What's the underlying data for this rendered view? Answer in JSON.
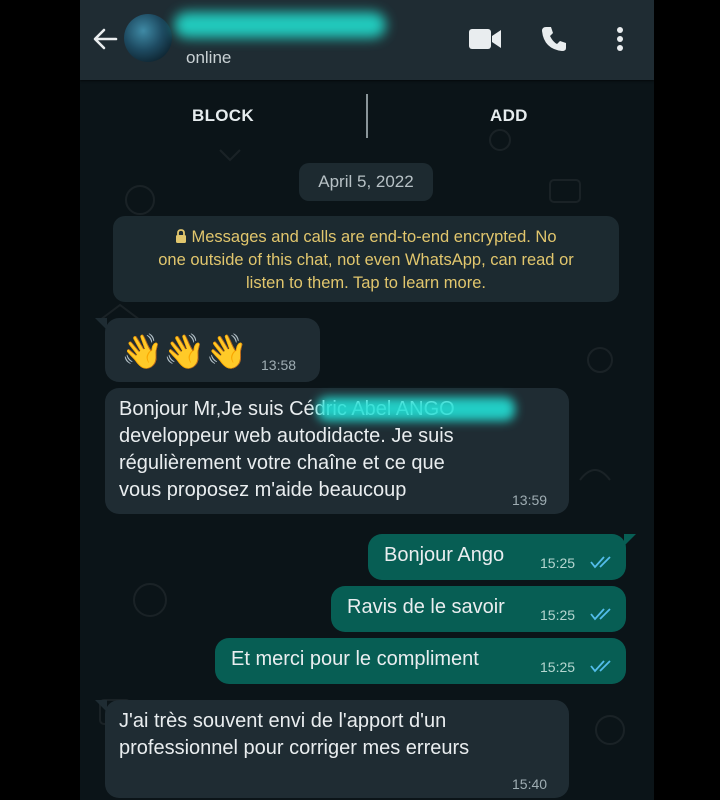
{
  "header": {
    "status": "online",
    "icons": [
      "back-arrow-icon",
      "avatar",
      "video-call-icon",
      "phone-call-icon",
      "more-options-icon"
    ]
  },
  "actions": {
    "block_label": "BLOCK",
    "add_label": "ADD"
  },
  "chat": {
    "date": "April 5, 2022",
    "encryption_lines": [
      "Messages and calls are end-to-end encrypted. No",
      "one outside of this chat, not even WhatsApp, can read or",
      "listen to them. Tap to learn more."
    ],
    "messages": [
      {
        "direction": "in",
        "text_lines": [
          "👋👋👋"
        ],
        "time": "13:58"
      },
      {
        "direction": "in",
        "text_lines": [
          "Bonjour Mr,Je suis Cédric Abel ANGO",
          "developpeur web autodidacte. Je suis",
          "régulièrement votre chaîne et ce que",
          "vous proposez m'aide beaucoup"
        ],
        "time": "13:59"
      },
      {
        "direction": "out",
        "text_lines": [
          "Bonjour Ango"
        ],
        "time": "15:25",
        "read": true
      },
      {
        "direction": "out",
        "text_lines": [
          "Ravis de le savoir"
        ],
        "time": "15:25",
        "read": true
      },
      {
        "direction": "out",
        "text_lines": [
          "Et merci pour le compliment"
        ],
        "time": "15:25",
        "read": true
      },
      {
        "direction": "in",
        "text_lines": [
          "J'ai très souvent envi de l'apport d'un",
          "professionnel pour corriger mes erreurs"
        ],
        "time": "15:40"
      }
    ]
  },
  "colors": {
    "header_bg": "#1f2c33",
    "chat_bg": "#0b1418",
    "incoming_bubble": "#1f2c33",
    "outgoing_bubble": "#075e54",
    "encryption_text": "#e1c66d",
    "read_ticks": "#53bdeb",
    "redaction": "#23e0d6"
  }
}
